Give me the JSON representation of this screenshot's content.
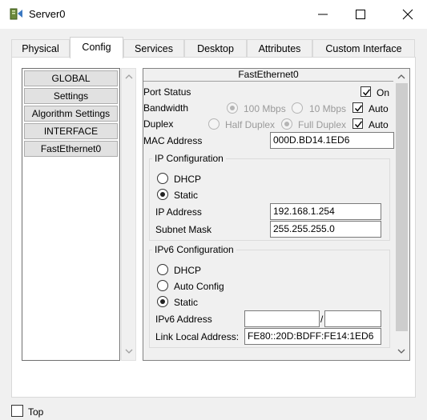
{
  "window": {
    "title": "Server0"
  },
  "tabs": [
    {
      "label": "Physical"
    },
    {
      "label": "Config"
    },
    {
      "label": "Services"
    },
    {
      "label": "Desktop"
    },
    {
      "label": "Attributes"
    },
    {
      "label": "Custom Interface"
    }
  ],
  "active_tab": "Config",
  "sidebar": {
    "items": [
      {
        "label": "GLOBAL"
      },
      {
        "label": "Settings"
      },
      {
        "label": "Algorithm Settings"
      },
      {
        "label": "INTERFACE"
      },
      {
        "label": "FastEthernet0"
      }
    ]
  },
  "interface": {
    "title": "FastEthernet0",
    "port_status": {
      "label": "Port Status",
      "checkbox_label": "On",
      "checked": true
    },
    "bandwidth": {
      "label": "Bandwidth",
      "options": [
        "100 Mbps",
        "10 Mbps"
      ],
      "auto_label": "Auto",
      "auto_checked": true
    },
    "duplex": {
      "label": "Duplex",
      "options": [
        "Half Duplex",
        "Full Duplex"
      ],
      "auto_label": "Auto",
      "auto_checked": true
    },
    "mac": {
      "label": "MAC Address",
      "value": "000D.BD14.1ED6"
    }
  },
  "ip_config": {
    "title": "IP Configuration",
    "dhcp_label": "DHCP",
    "static_label": "Static",
    "selected": "Static",
    "ip_label": "IP Address",
    "ip_value": "192.168.1.254",
    "mask_label": "Subnet Mask",
    "mask_value": "255.255.255.0"
  },
  "ipv6_config": {
    "title": "IPv6 Configuration",
    "dhcp_label": "DHCP",
    "auto_label": "Auto Config",
    "static_label": "Static",
    "selected": "Static",
    "addr_label": "IPv6 Address",
    "addr_value": "",
    "prefix_value": "",
    "separator": "/",
    "link_local_label": "Link Local Address:",
    "link_local_value": "FE80::20D:BDFF:FE14:1ED6"
  },
  "footer": {
    "top_label": "Top",
    "top_checked": false
  }
}
